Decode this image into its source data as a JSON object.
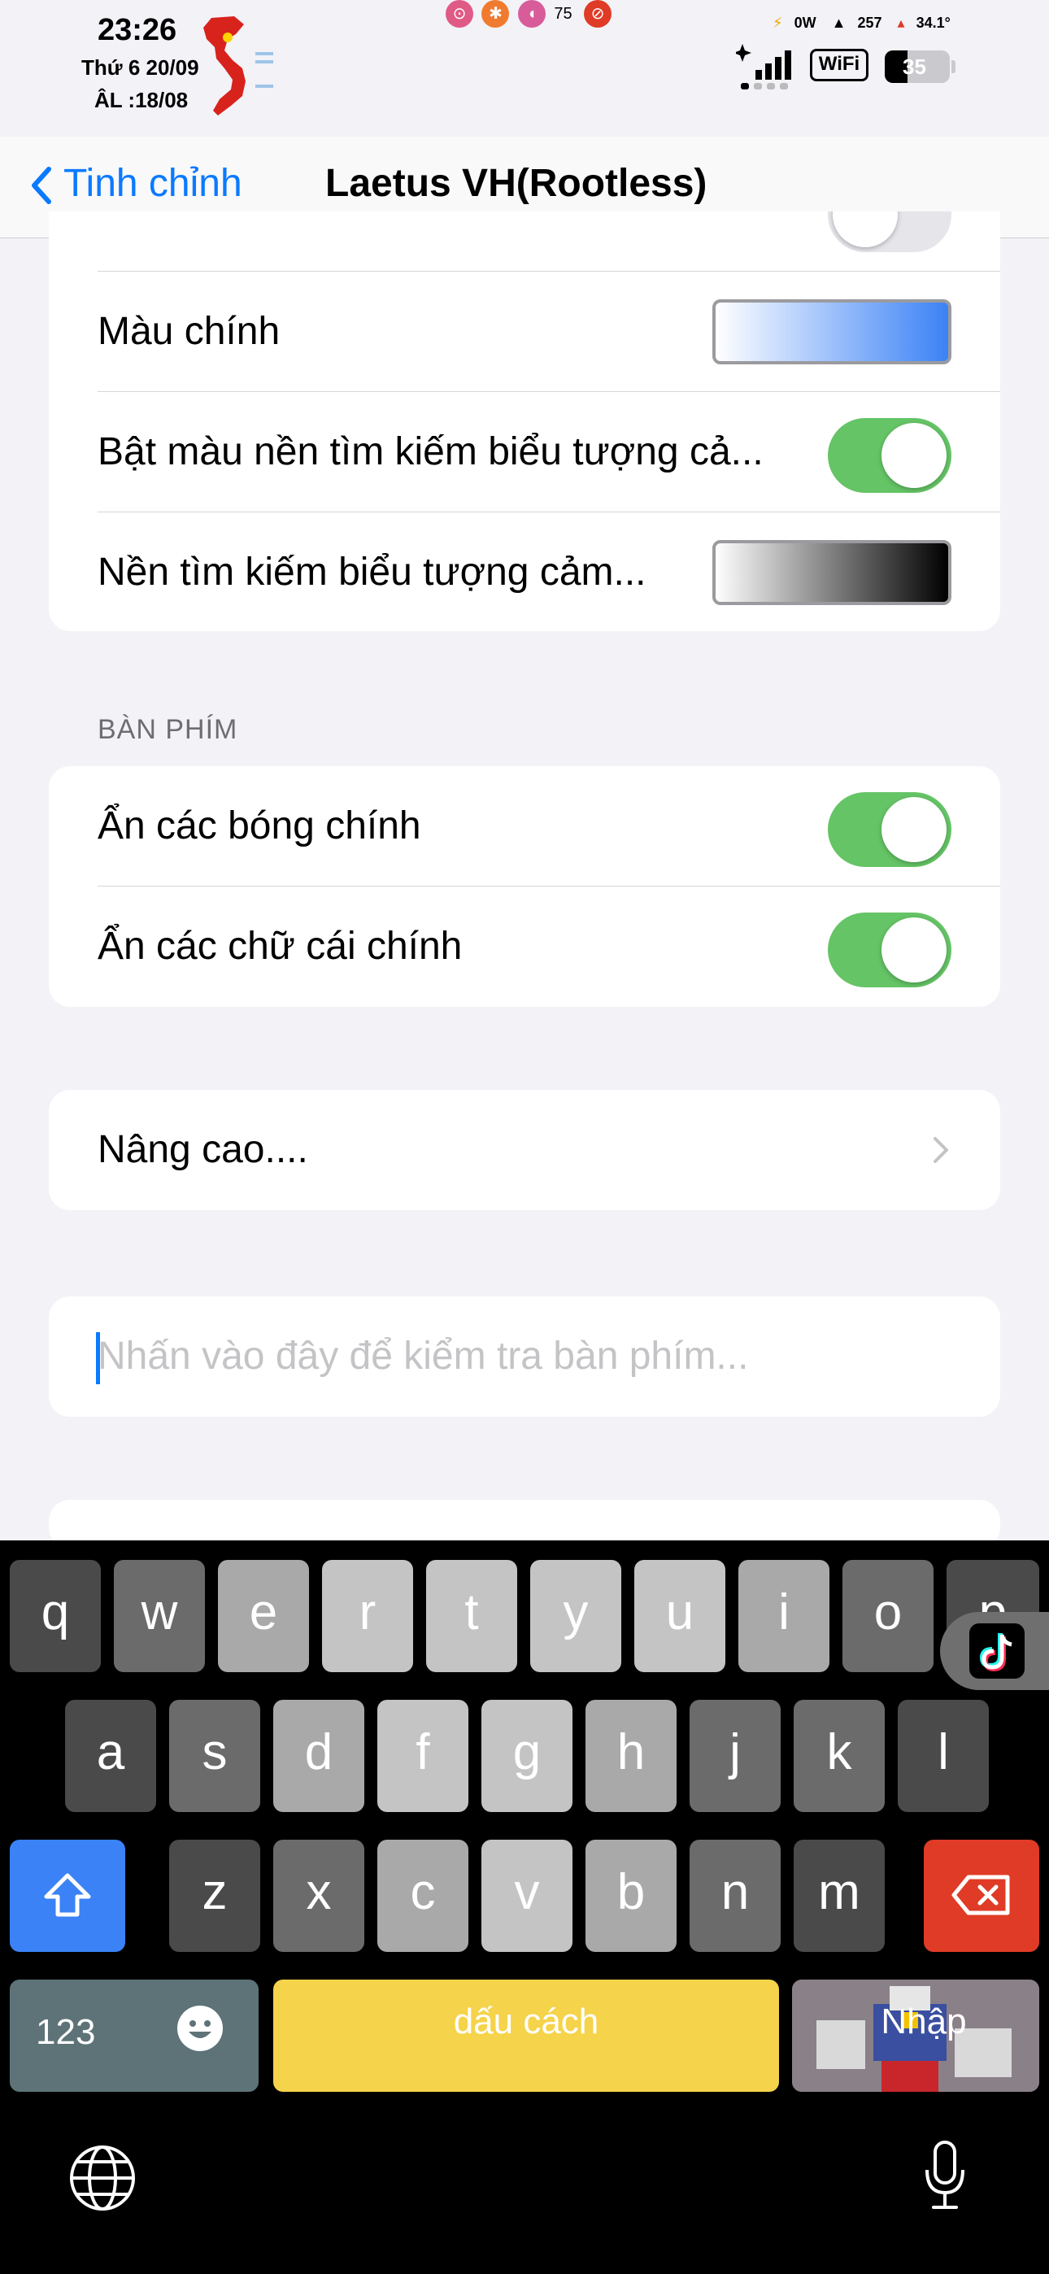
{
  "status_bar": {
    "time": "23:26",
    "date": "Thứ 6 20/09",
    "lunar_date": "ÂL :18/08",
    "volume": "75",
    "power": "0W",
    "data": "257",
    "temperature": "34.1°",
    "wifi_label": "WiFi",
    "battery": "35"
  },
  "nav": {
    "back_label": "Tinh chỉnh",
    "title": "Laetus VH(Rootless)"
  },
  "appearance": {
    "rows": [
      {
        "label": "Màu chính",
        "control": "gradient",
        "colors": [
          "#ffffff",
          "#3b82f6"
        ]
      },
      {
        "label": "Bật màu nền tìm kiếm biểu tượng cả...",
        "control": "toggle",
        "on": true
      },
      {
        "label": "Nền tìm kiếm biểu tượng cảm...",
        "control": "gradient",
        "colors": [
          "#ffffff",
          "#000000"
        ]
      }
    ]
  },
  "keyboard_section": {
    "header": "BÀN PHÍM",
    "rows": [
      {
        "label": "Ẩn các bóng chính",
        "on": true
      },
      {
        "label": "Ẩn các chữ cái chính",
        "on": true
      }
    ]
  },
  "advanced": {
    "label": "Nâng cao...."
  },
  "test_input": {
    "placeholder": "Nhấn vào đây để kiểm tra bàn phím..."
  },
  "keyboard": {
    "row1": [
      "q",
      "w",
      "e",
      "r",
      "t",
      "y",
      "u",
      "i",
      "o",
      "p"
    ],
    "row2": [
      "a",
      "s",
      "d",
      "f",
      "g",
      "h",
      "j",
      "k",
      "l"
    ],
    "row3": [
      "z",
      "x",
      "c",
      "v",
      "b",
      "n",
      "m"
    ],
    "numbers_label": "123",
    "space_label": "dấu cách",
    "enter_label": "Nhập"
  },
  "colors": {
    "accent": "#0a7aff",
    "toggle_on": "#65c466",
    "shift": "#3a82f6",
    "delete": "#e03b26",
    "space": "#f5d34a"
  }
}
